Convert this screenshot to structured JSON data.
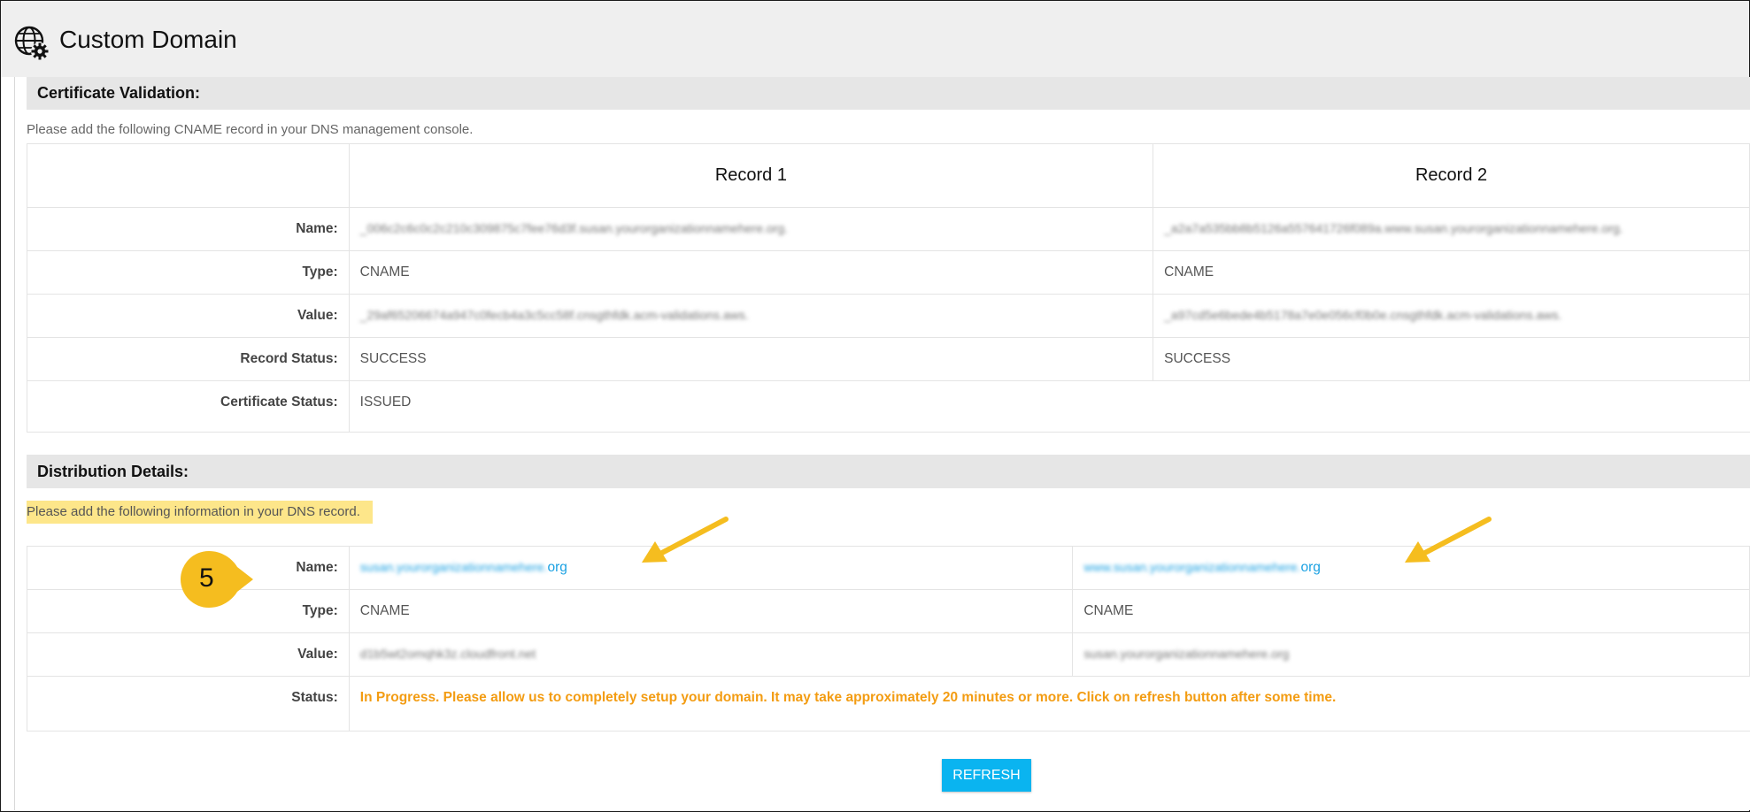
{
  "header": {
    "title": "Custom Domain",
    "icon": "globe-gear-icon"
  },
  "certificate": {
    "section_title": "Certificate Validation:",
    "instruction": "Please add the following CNAME record in your DNS management console.",
    "columns": [
      "Record 1",
      "Record 2"
    ],
    "labels": {
      "name": "Name:",
      "type": "Type:",
      "value": "Value:",
      "record_status": "Record Status:",
      "certificate_status": "Certificate Status:"
    },
    "records": [
      {
        "name": "_006c2c6c0c2c210c309875c7fee76d3f.susan.yourorganizationnamehere.org.",
        "type": "CNAME",
        "value": "_29af65206674a947c0fecb4a3c5cc58f.cnsgthfdk.acm-validations.aws.",
        "record_status": "SUCCESS"
      },
      {
        "name": "_a2a7a535bb8b5126a557641726f089a.www.susan.yourorganizationnamehere.org.",
        "type": "CNAME",
        "value": "_a97cd5e6bede4b5178a7e0e056cf0b0e.cnsgthfdk.acm-validations.aws.",
        "record_status": "SUCCESS"
      }
    ],
    "certificate_status": "ISSUED"
  },
  "distribution": {
    "section_title": "Distribution Details:",
    "instruction": "Please add the following information in your DNS record.",
    "labels": {
      "name": "Name:",
      "type": "Type:",
      "value": "Value:",
      "status": "Status:"
    },
    "records": [
      {
        "name_prefix": "susan.yourorganizationnamehere.",
        "name_suffix": "org",
        "type": "CNAME",
        "value": "d1b5wt2omqhk3z.cloudfront.net"
      },
      {
        "name_prefix": "www.susan.yourorganizationnamehere.",
        "name_suffix": "org",
        "type": "CNAME",
        "value": "susan.yourorganizationnamehere.org"
      }
    ],
    "status": "In Progress. Please allow us to completely setup your domain. It may take approximately 20 minutes or more. Click on refresh button after some time."
  },
  "annotations": {
    "step_number": "5",
    "badge_color": "#f5bd1f",
    "arrow_color": "#f5bd1f"
  },
  "actions": {
    "refresh_label": "REFRESH"
  },
  "colors": {
    "accent": "#0ab4f0",
    "link": "#1ba1e2",
    "in_progress": "#f39c12",
    "highlight": "#fde68a"
  }
}
